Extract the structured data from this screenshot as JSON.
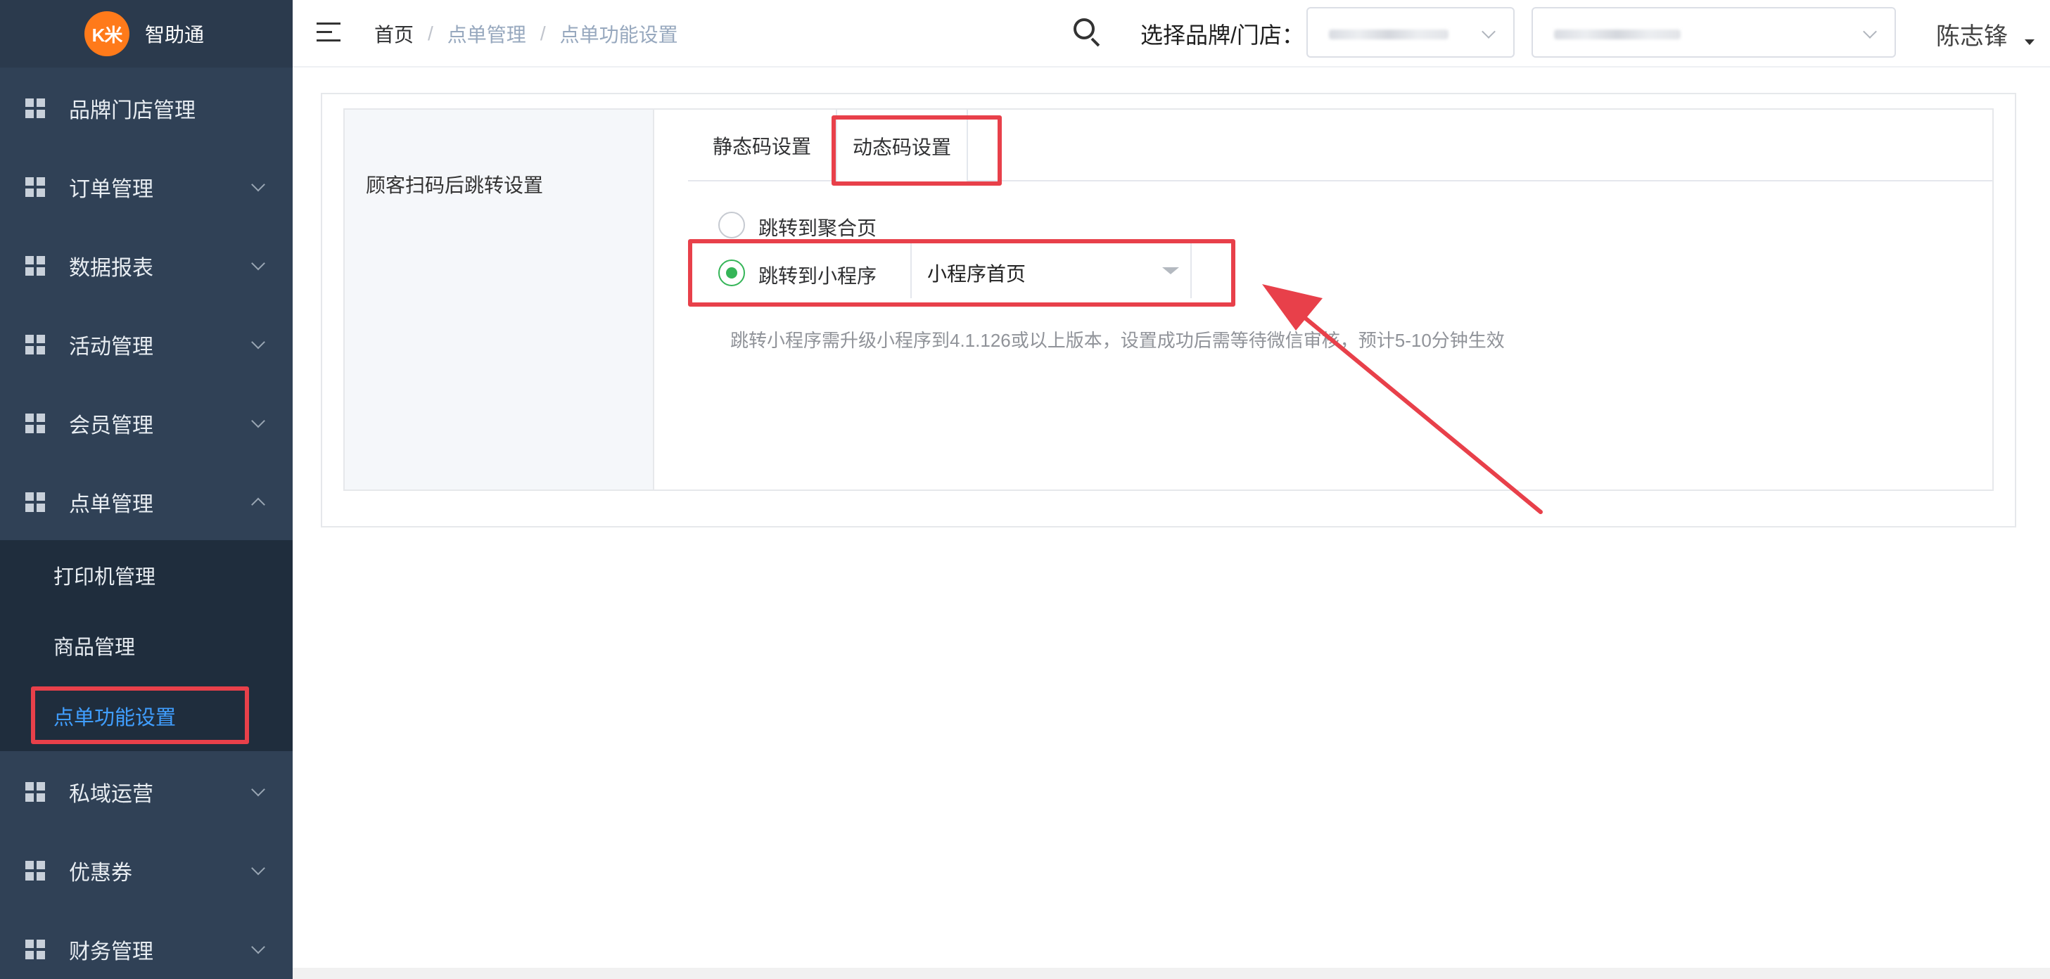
{
  "app": {
    "logo_text": "K米",
    "name": "智助通"
  },
  "sidebar": {
    "items": [
      {
        "label": "品牌门店管理",
        "expandable": false
      },
      {
        "label": "订单管理",
        "expandable": true
      },
      {
        "label": "数据报表",
        "expandable": true
      },
      {
        "label": "活动管理",
        "expandable": true
      },
      {
        "label": "会员管理",
        "expandable": true
      },
      {
        "label": "点单管理",
        "expandable": true,
        "expanded": true
      },
      {
        "label": "私域运营",
        "expandable": true
      },
      {
        "label": "优惠券",
        "expandable": true
      },
      {
        "label": "财务管理",
        "expandable": true
      }
    ],
    "submenu": [
      {
        "label": "打印机管理"
      },
      {
        "label": "商品管理"
      },
      {
        "label": "点单功能设置",
        "active": true
      }
    ]
  },
  "header": {
    "breadcrumb": [
      "首页",
      "点单管理",
      "点单功能设置"
    ],
    "breadcrumb_sep": "/",
    "brand_store_label": "选择品牌/门店：",
    "user_name": "陈志锋"
  },
  "main": {
    "row_label": "顾客扫码后跳转设置",
    "tabs": [
      {
        "label": "静态码设置"
      },
      {
        "label": "动态码设置",
        "active": true
      }
    ],
    "options": [
      {
        "label": "跳转到聚合页",
        "checked": false
      },
      {
        "label": "跳转到小程序",
        "checked": true
      }
    ],
    "miniprogram_select": {
      "value": "小程序首页"
    },
    "hint": "跳转小程序需升级小程序到4.1.126或以上版本，设置成功后需等待微信审核，预计5-10分钟生效"
  },
  "colors": {
    "sidebar_bg": "#304156",
    "submenu_bg": "#1f2d3d",
    "active_link": "#409eff",
    "radio_checked": "#35b558",
    "annotation_red": "#e8404a",
    "logo_orange": "#ff7a1a"
  }
}
